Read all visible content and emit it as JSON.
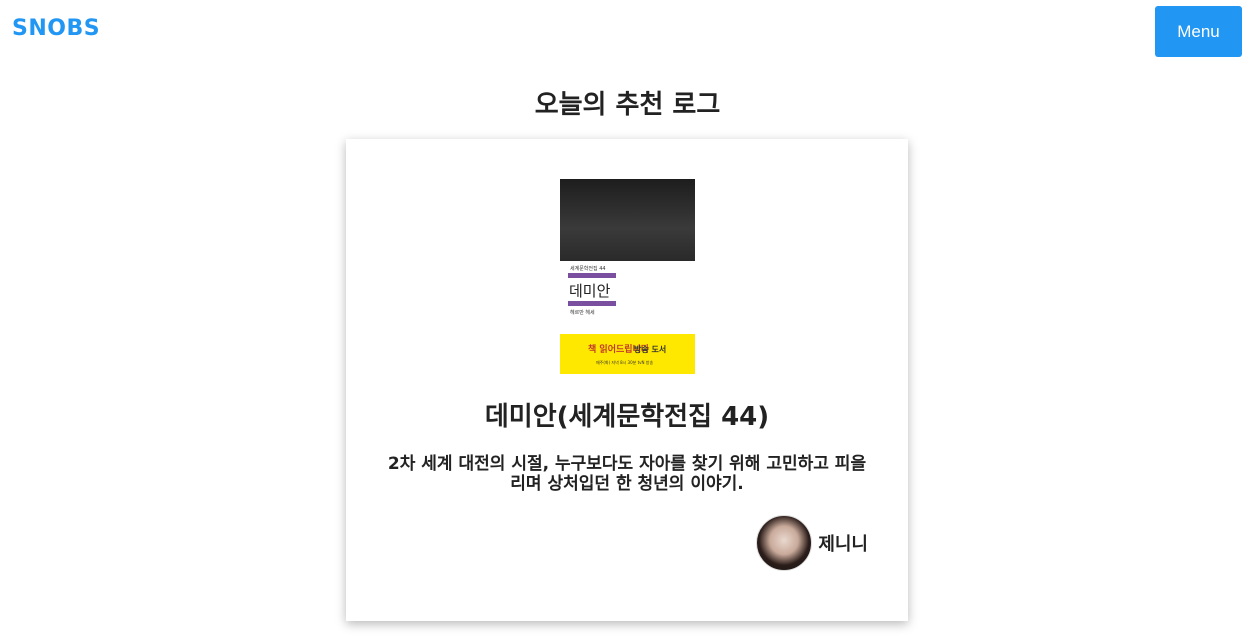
{
  "header": {
    "logo": "SNOBS",
    "menu_label": "Menu"
  },
  "section": {
    "title": "오늘의 추천 로그"
  },
  "card": {
    "cover": {
      "series": "세계문학전집 44",
      "title": "데미안",
      "author": "헤르만 헤세",
      "banner_logo": "책 읽어드립니다",
      "banner_tag": "방송 도서",
      "banner_sub": "매주(화) 저녁 8시 30분 tvN 방송"
    },
    "book_title": "데미안(세계문학전집 44)",
    "description": "2차 세계 대전의 시절, 누구보다도 자아를 찾기 위해 고민하고 피을리며 상처입던 한 청년의 이야기.",
    "author_name": "제니니"
  },
  "colors": {
    "brand": "#2196F3",
    "text": "#222222",
    "cover_accent": "#7b4fa0",
    "banner": "#ffe800"
  },
  "icons": {
    "avatar": "user-avatar-photo"
  }
}
